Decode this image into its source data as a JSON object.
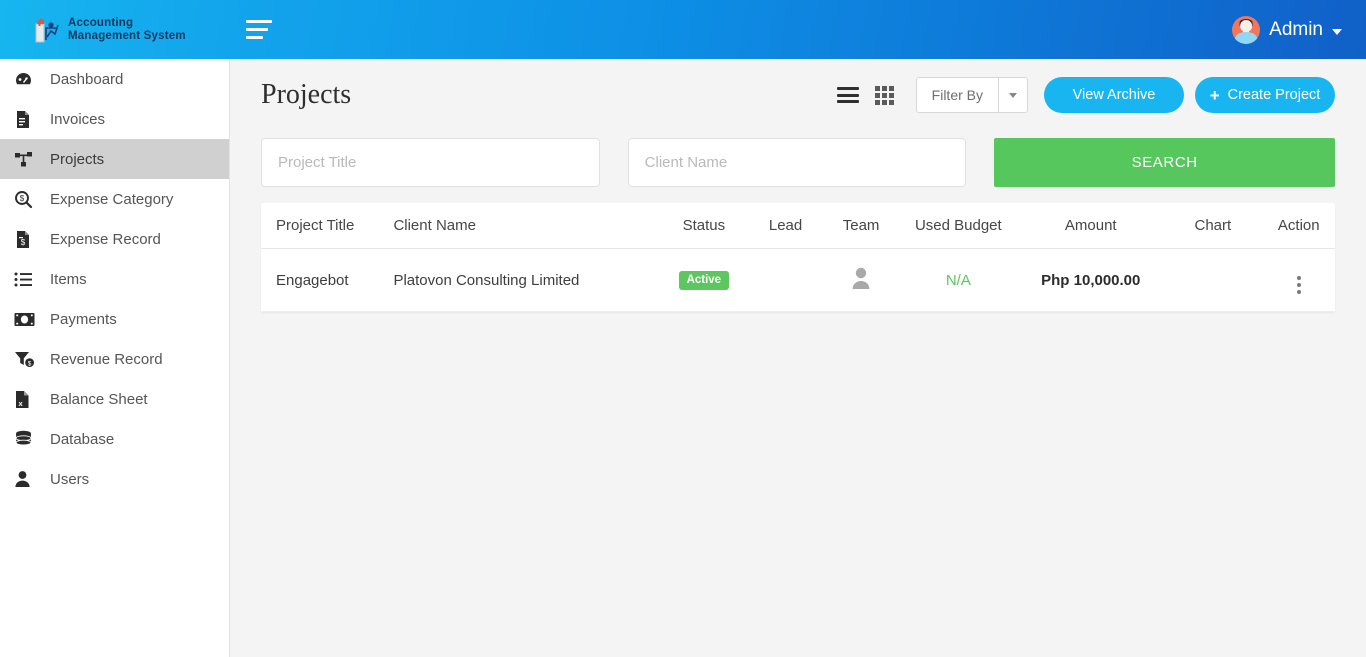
{
  "brand": {
    "name": "Accounting Management System",
    "logo_icon": "building-chart-logo-icon",
    "menu_toggle_icon": "hamburger-icon"
  },
  "topbar": {
    "user_name": "Admin",
    "user_avatar_icon": "user-avatar",
    "caret_icon": "chevron-down-icon"
  },
  "sidebar": {
    "items": [
      {
        "label": "Dashboard",
        "icon": "dashboard-gauge-icon",
        "active": false
      },
      {
        "label": "Invoices",
        "icon": "invoice-document-icon",
        "active": false
      },
      {
        "label": "Projects",
        "icon": "project-nodes-icon",
        "active": true
      },
      {
        "label": "Expense Category",
        "icon": "magnifier-dollar-icon",
        "active": false
      },
      {
        "label": "Expense Record",
        "icon": "document-dollar-icon",
        "active": false
      },
      {
        "label": "Items",
        "icon": "list-icon",
        "active": false
      },
      {
        "label": "Payments",
        "icon": "money-bill-icon",
        "active": false
      },
      {
        "label": "Revenue Record",
        "icon": "funnel-dollar-icon",
        "active": false
      },
      {
        "label": "Balance Sheet",
        "icon": "excel-file-icon",
        "active": false
      },
      {
        "label": "Database",
        "icon": "database-icon",
        "active": false
      },
      {
        "label": "Users",
        "icon": "user-icon",
        "active": false
      }
    ]
  },
  "page": {
    "title": "Projects"
  },
  "toolbar": {
    "list_view_icon": "list-view-icon",
    "grid_view_icon": "grid-view-icon",
    "filter_label": "Filter By",
    "filter_caret_icon": "chevron-down-icon",
    "view_archive_label": "View Archive",
    "create_project_label": "Create Project",
    "create_project_icon": "plus-icon",
    "accent_blue": "#19b5f0"
  },
  "search": {
    "project_title_value": "",
    "project_title_placeholder": "Project Title",
    "client_name_value": "",
    "client_name_placeholder": "Client Name",
    "search_label": "SEARCH",
    "search_color": "#56c75c"
  },
  "table": {
    "headers": [
      "Project Title",
      "Client Name",
      "Status",
      "Lead",
      "Team",
      "Used Budget",
      "Amount",
      "Chart",
      "Action"
    ],
    "rows": [
      {
        "project_title": "Engagebot",
        "client_name": "Platovon Consulting Limited",
        "status": "Active",
        "status_color": "#5cc75f",
        "lead_icon": "user-avatar",
        "team_icon": "user-silhouette-icon",
        "used_budget": "N/A",
        "used_budget_color": "#5cc75f",
        "amount": "Php 10,000.00",
        "chart": "",
        "action_icon": "vertical-dots-icon"
      }
    ]
  }
}
